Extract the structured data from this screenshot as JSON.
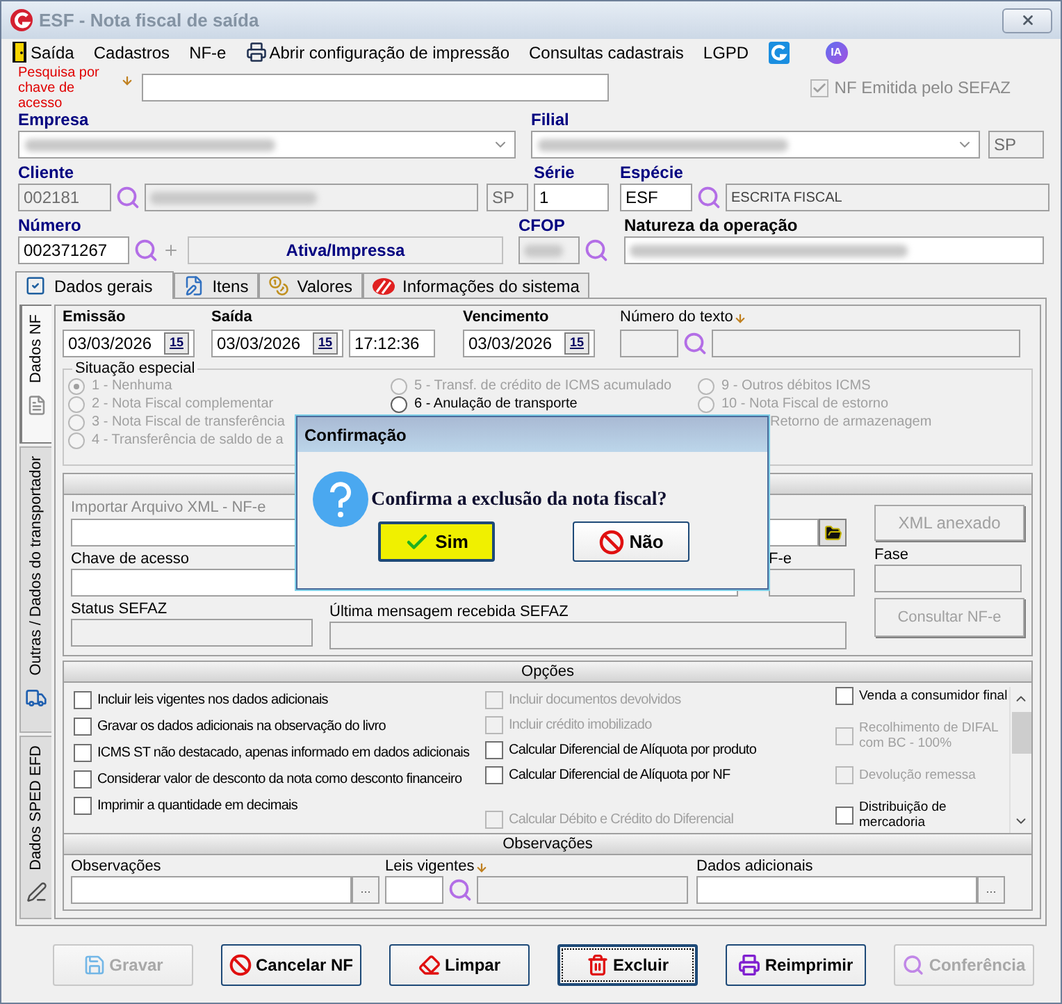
{
  "window": {
    "title": "ESF - Nota fiscal de saída"
  },
  "menu": [
    {
      "kind": "door",
      "label": "Saída"
    },
    {
      "kind": "plain",
      "label": "Cadastros"
    },
    {
      "kind": "plain",
      "label": "NF-e"
    },
    {
      "kind": "printer",
      "label": "Abrir configuração de impressão"
    },
    {
      "kind": "plain",
      "label": "Consultas cadastrais"
    },
    {
      "kind": "plain",
      "label": "LGPD"
    },
    {
      "kind": "logo"
    },
    {
      "kind": "badge",
      "label": "IA"
    }
  ],
  "search": {
    "label": "Pesquisa por chave de acesso"
  },
  "nf_emitida": {
    "label": "NF Emitida pelo SEFAZ",
    "checked": true,
    "disabled": true
  },
  "empresa": {
    "label": "Empresa"
  },
  "filial": {
    "label": "Filial",
    "uf": "SP"
  },
  "cliente": {
    "label": "Cliente",
    "code": "002181",
    "uf": "SP"
  },
  "serie": {
    "label": "Série",
    "value": "1"
  },
  "especie": {
    "label": "Espécie",
    "code": "ESF",
    "description": "ESCRITA FISCAL"
  },
  "numero": {
    "label": "Número",
    "value": "002371267",
    "status": "Ativa/Impressa"
  },
  "cfop": {
    "label": "CFOP"
  },
  "natureza": {
    "label": "Natureza da operação"
  },
  "tabs": [
    {
      "label": "Dados gerais",
      "selected": true
    },
    {
      "label": "Itens",
      "selected": false
    },
    {
      "label": "Valores",
      "selected": false
    },
    {
      "label": "Informações do sistema",
      "selected": false
    }
  ],
  "side_tabs": [
    {
      "label": "Dados NF",
      "selected": true
    },
    {
      "label": "Outras / Dados do transportador",
      "selected": false
    },
    {
      "label": "Dados SPED EFD",
      "selected": false
    }
  ],
  "emissao": {
    "label": "Emissão",
    "value": "03/03/2026",
    "calendar": "15"
  },
  "saida": {
    "label": "Saída",
    "value": "03/03/2026",
    "calendar": "15",
    "time": "17:12:36"
  },
  "vencimento": {
    "label": "Vencimento",
    "value": "03/03/2026",
    "calendar": "15"
  },
  "numero_texto": {
    "label": "Número do texto"
  },
  "situacao": {
    "title": "Situação especial",
    "columns": [
      {
        "options": [
          {
            "label": "1 - Nenhuma",
            "selected": true,
            "disabled": true
          },
          {
            "label": "2 - Nota Fiscal complementar",
            "selected": false,
            "disabled": true
          },
          {
            "label": "3 - Nota Fiscal de transferência",
            "selected": false,
            "disabled": true
          },
          {
            "label": "4 - Transferência de saldo de a",
            "selected": false,
            "disabled": true
          }
        ]
      },
      {
        "options": [
          {
            "label": "5 - Transf. de crédito de ICMS acumulado",
            "selected": false,
            "disabled": true
          },
          {
            "label": "6 - Anulação de transporte",
            "selected": false,
            "disabled": false
          }
        ]
      },
      {
        "options": [
          {
            "label": "9 - Outros débitos ICMS",
            "selected": false,
            "disabled": true
          },
          {
            "label": "10 - Nota Fiscal de estorno",
            "selected": false,
            "disabled": true
          },
          {
            "label": "Retorno de armazenagem",
            "disabled": true,
            "kind": "partial"
          }
        ]
      }
    ]
  },
  "nfe": {
    "import_label": "Importar Arquivo XML - NF-e",
    "xml_button": "XML anexado",
    "chave_label": "Chave de acesso",
    "protocol_label": "F-e",
    "fase_label": "Fase",
    "status_label": "Status SEFAZ",
    "mensagem_label": "Última mensagem recebida SEFAZ",
    "consultar_button": "Consultar NF-e"
  },
  "opcoes": {
    "title": "Opções",
    "columns": [
      {
        "items": [
          {
            "label": "Incluir leis vigentes nos dados adicionais",
            "checked": false,
            "disabled": false
          },
          {
            "label": "Gravar os dados adicionais na observação do livro",
            "checked": false,
            "disabled": false
          },
          {
            "label": "ICMS ST  não destacado, apenas informado em dados adicionais",
            "checked": false,
            "disabled": false
          },
          {
            "label": "Considerar valor de desconto da nota como desconto financeiro",
            "checked": false,
            "disabled": false
          },
          {
            "label": "Imprimir a quantidade em decimais",
            "checked": false,
            "disabled": false
          }
        ]
      },
      {
        "items": [
          {
            "label": "Incluir documentos devolvidos",
            "checked": false,
            "disabled": true
          },
          {
            "label": "Incluir crédito imobilizado",
            "checked": false,
            "disabled": true
          },
          {
            "label": "Calcular Diferencial de Alíquota por produto",
            "checked": false,
            "disabled": false
          },
          {
            "label": "Calcular Diferencial de Alíquota por NF",
            "checked": false,
            "disabled": false
          },
          {
            "label": "Calcular Débito e Crédito do Diferencial",
            "checked": false,
            "disabled": true,
            "kind": "spaced"
          }
        ]
      },
      {
        "items": [
          {
            "label": "Venda a consumidor final",
            "checked": false,
            "disabled": false
          },
          {
            "label": "Recolhimento de DIFAL com BC - 100%",
            "checked": false,
            "disabled": true
          },
          {
            "label": "Devolução remessa",
            "checked": false,
            "disabled": true
          },
          {
            "label": "Distribuição de mercadoria",
            "checked": false,
            "disabled": false
          }
        ]
      }
    ]
  },
  "observacoes": {
    "title": "Observações",
    "obs_label": "Observações",
    "obs_button": "...",
    "leis_label": "Leis vigentes",
    "dados_label": "Dados adicionais",
    "dados_button": "..."
  },
  "buttons": [
    {
      "label": "Gravar",
      "disabled": true,
      "focused": false
    },
    {
      "label": "Cancelar NF",
      "disabled": false,
      "focused": false
    },
    {
      "label": "Limpar",
      "disabled": false,
      "focused": false
    },
    {
      "label": "Excluir",
      "disabled": false,
      "focused": true
    },
    {
      "label": "Reimprimir",
      "disabled": false,
      "focused": false
    },
    {
      "label": "Conferência",
      "disabled": true,
      "focused": false
    }
  ],
  "dialog": {
    "title": "Confirmação",
    "message": "Confirma a exclusão da nota fiscal?",
    "buttons": [
      {
        "label": "Sim",
        "selected": true
      },
      {
        "label": "Não",
        "selected": false
      }
    ]
  }
}
